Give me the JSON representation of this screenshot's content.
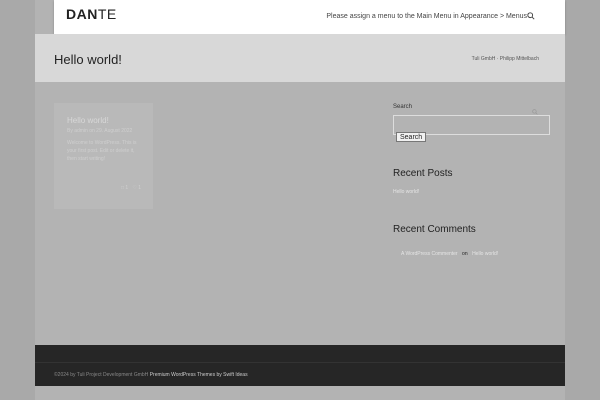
{
  "header": {
    "logo_bold": "DAN",
    "logo_light": "TE",
    "menu_note": "Please assign a menu to the Main Menu in Appearance > Menus",
    "search_icon": "search-icon"
  },
  "titlebar": {
    "title": "Hello world!",
    "breadcrumb": "Tuli GmbH · Philipp Mittelbach"
  },
  "post": {
    "title": "Hello world!",
    "meta": "By admin on 29. August 2022",
    "excerpt": "Welcome to WordPress. This is your first post. Edit or delete it, then start writing!",
    "comments_count": "1",
    "likes_count": "1"
  },
  "sidebar": {
    "search_label": "Search",
    "search_value": "",
    "search_button": "Search",
    "recent_posts_title": "Recent Posts",
    "recent_posts": [
      "Hello world!"
    ],
    "recent_comments_title": "Recent Comments",
    "comment_author": "A WordPress Commenter",
    "comment_on": "on",
    "comment_post": "Hello world!"
  },
  "footer": {
    "text": "©2024 by Tuli Project Development GmbH",
    "link": "Premium WordPress Themes by Swift Ideas"
  }
}
